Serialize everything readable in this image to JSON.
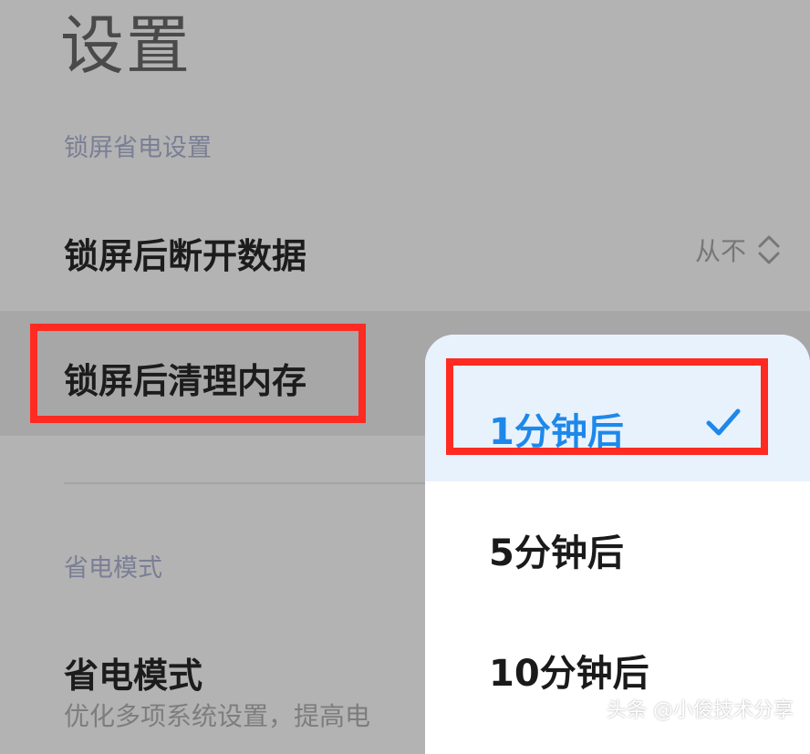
{
  "header": {
    "title": "设置"
  },
  "sections": {
    "lock_screen": {
      "header": "锁屏省电设置",
      "items": [
        {
          "label": "锁屏后断开数据",
          "value": "从不",
          "icon": "chevron-up-down-icon"
        },
        {
          "label": "锁屏后清理内存"
        }
      ]
    },
    "power_saving": {
      "header": "省电模式",
      "items": [
        {
          "label": "省电模式",
          "subtitle": "优化多项系统设置，提高电"
        }
      ]
    }
  },
  "popup": {
    "options": [
      {
        "label": "1分钟后",
        "selected": true,
        "icon": "check-icon"
      },
      {
        "label": "5分钟后",
        "selected": false
      },
      {
        "label": "10分钟后",
        "selected": false
      }
    ]
  },
  "watermark": "头条 @小俊技术分享",
  "colors": {
    "accent": "#1e88ea",
    "annotation": "#ff2b22",
    "overlay_background": "#b3b3b3"
  }
}
